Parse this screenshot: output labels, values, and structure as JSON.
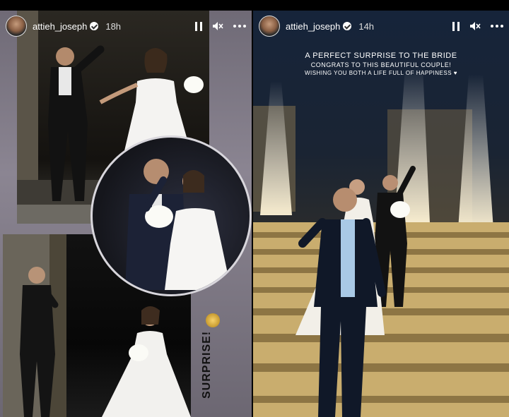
{
  "stories": [
    {
      "user": "attieh_joseph",
      "time": "18h",
      "sticker_text": "SURPRISE!"
    },
    {
      "user": "attieh_joseph",
      "time": "14h",
      "caption": {
        "line1": "A PERFECT SURPRISE TO THE BRIDE",
        "line2": "CONGRATS TO THIS BEAUTIFUL COUPLE!",
        "line3": "WISHING YOU BOTH A LIFE FULL OF HAPPINESS ♥"
      }
    }
  ],
  "icons": {
    "pause": "pause-icon",
    "mute": "mute-icon",
    "more": "more-icon",
    "verified": "verified-badge-icon"
  },
  "colors": {
    "header_text": "#ffffff",
    "left_bg": "#7d7884",
    "right_bg": "#1f2b40"
  }
}
